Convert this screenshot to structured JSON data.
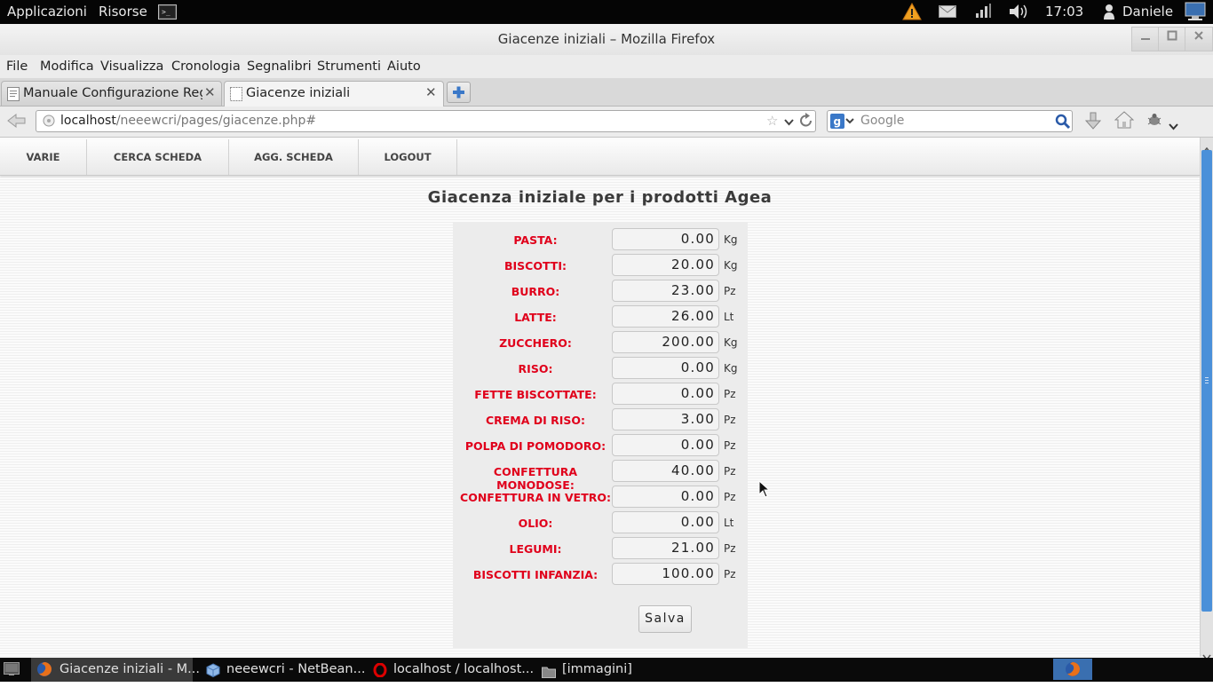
{
  "top_panel": {
    "applications": "Applicazioni",
    "places": "Risorse",
    "clock": "17:03",
    "user": "Daniele"
  },
  "window": {
    "title": "Giacenze iniziali – Mozilla Firefox"
  },
  "menubar": [
    "File",
    "Modifica",
    "Visualizza",
    "Cronologia",
    "Segnalibri",
    "Strumenti",
    "Aiuto"
  ],
  "tabs": [
    {
      "label": "Manuale Configurazione Reg..."
    },
    {
      "label": "Giacenze iniziali"
    }
  ],
  "navbar": {
    "url_host": "localhost",
    "url_path": "/neeewcri/pages/giacenze.php#",
    "search_placeholder": "Google"
  },
  "site_nav": [
    "VARIE",
    "CERCA SCHEDA",
    "AGG. SCHEDA",
    "LOGOUT"
  ],
  "page": {
    "title": "Giacenza iniziale per i prodotti Agea",
    "save_label": "Salva",
    "rows": [
      {
        "label": "PASTA:",
        "value": "0.00",
        "unit": "Kg"
      },
      {
        "label": "BISCOTTI:",
        "value": "20.00",
        "unit": "Kg"
      },
      {
        "label": "BURRO:",
        "value": "23.00",
        "unit": "Pz"
      },
      {
        "label": "LATTE:",
        "value": "26.00",
        "unit": "Lt"
      },
      {
        "label": "ZUCCHERO:",
        "value": "200.00",
        "unit": "Kg"
      },
      {
        "label": "RISO:",
        "value": "0.00",
        "unit": "Kg"
      },
      {
        "label": "FETTE BISCOTTATE:",
        "value": "0.00",
        "unit": "Pz"
      },
      {
        "label": "CREMA DI RISO:",
        "value": "3.00",
        "unit": "Pz"
      },
      {
        "label": "POLPA DI POMODORO:",
        "value": "0.00",
        "unit": "Pz"
      },
      {
        "label": "CONFETTURA MONODOSE:",
        "value": "40.00",
        "unit": "Pz"
      },
      {
        "label": "CONFETTURA IN VETRO:",
        "value": "0.00",
        "unit": "Pz"
      },
      {
        "label": "OLIO:",
        "value": "0.00",
        "unit": "Lt"
      },
      {
        "label": "LEGUMI:",
        "value": "21.00",
        "unit": "Pz"
      },
      {
        "label": "BISCOTTI INFANZIA:",
        "value": "100.00",
        "unit": "Pz"
      }
    ]
  },
  "taskbar": [
    {
      "label": "Giacenze iniziali - M..."
    },
    {
      "label": "neeewcri - NetBean..."
    },
    {
      "label": "localhost / localhost..."
    },
    {
      "label": "[immagini]"
    }
  ],
  "colors": {
    "label_red": "#e0001b",
    "scroll_blue": "#4a90d9",
    "panel_black": "#050505"
  }
}
